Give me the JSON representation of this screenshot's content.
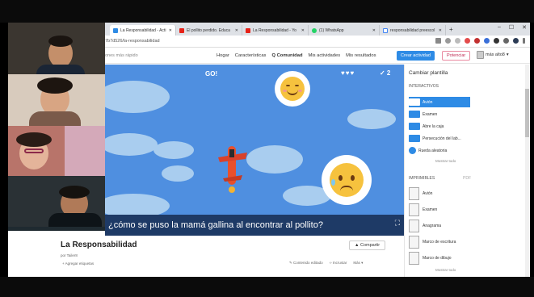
{
  "browser": {
    "tabs": [
      {
        "title": "La Responsabilidad - Acti",
        "active": true,
        "icon": "wordwall-icon",
        "color": "#2e8be5"
      },
      {
        "title": "El pollito perdido. Educa",
        "active": false,
        "icon": "youtube-icon",
        "color": "#e62117"
      },
      {
        "title": "La Responsabilidad - Yo",
        "active": false,
        "icon": "youtube-icon",
        "color": "#e62117"
      },
      {
        "title": "(1) WhatsApp",
        "active": false,
        "icon": "whatsapp-icon",
        "color": "#25d366"
      },
      {
        "title": "responsabilidad preescol",
        "active": false,
        "icon": "google-icon",
        "color": "#4285f4"
      }
    ],
    "url": "7b7d526/la-responsabilidad"
  },
  "nav": {
    "search_placeholder": "ones más rápido",
    "links": [
      "Hogar",
      "Características",
      "Comunidad",
      "Mis actividades",
      "Mis resultados"
    ],
    "create_button": "Crear actividad",
    "boost_button": "Potenciar",
    "user_label": "más alto8"
  },
  "game": {
    "go_label": "GO!",
    "hearts": "♥♥♥",
    "score": "✓ 2",
    "question": "¿cómo se puso la mamá gallina al encontrar al pollito?"
  },
  "panel": {
    "title": "Cambiar plantilla",
    "interactive_label": "INTERACTIVOS",
    "interactive_items": [
      "Avión",
      "Examen",
      "Abre la caja",
      "Persecución del lab...",
      "Rueda aleatoria"
    ],
    "show_all": "Mostrar todo",
    "printable_label": "IMPRIMIBLES",
    "pdf_label": "PDF",
    "printable_items": [
      "Avión",
      "Examen",
      "Anagrama",
      "Marco de escritura",
      "Marco de dibujo"
    ],
    "show_all_2": "Mostrar todo"
  },
  "activity": {
    "title": "La Responsabilidad",
    "by": "por Tailer8",
    "add_tags": "+ Agregar etiquetas",
    "share_button": "Compartir",
    "edit_content": "Contenido editado",
    "embed": "Incrustar",
    "more": "Más"
  },
  "colors": {
    "accent": "#2e8be5",
    "sky": "#4f8fe0",
    "question_bar": "#1e3a66"
  }
}
